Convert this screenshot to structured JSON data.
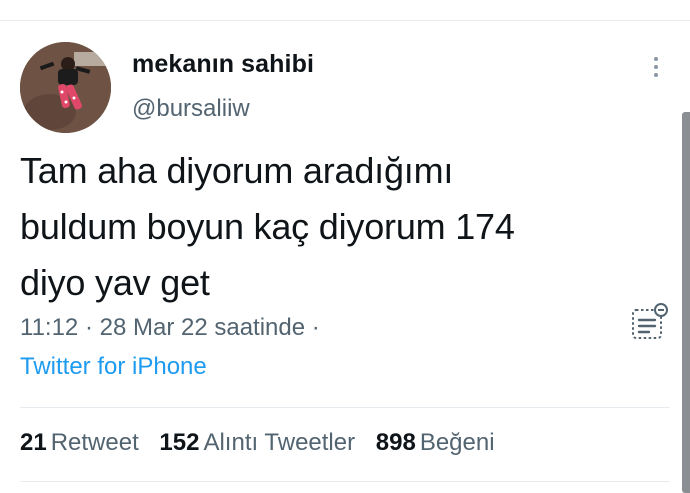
{
  "tweet": {
    "display_name": "mekanın sahibi",
    "handle": "@bursaliiw",
    "text_lines": [
      "Tam aha diyorum aradığımı",
      "buldum boyun kaç diyorum 174",
      "diyo yav get"
    ],
    "time": "11:12",
    "separator": "·",
    "date": "28 Mar 22 saatinde",
    "trailing_separator": "·",
    "source": "Twitter for iPhone"
  },
  "stats": {
    "retweets": {
      "count": "21",
      "label": "Retweet"
    },
    "quotes": {
      "count": "152",
      "label": "Alıntı Tweetler"
    },
    "likes": {
      "count": "898",
      "label": "Beğeni"
    }
  },
  "icons": {
    "more": "more-vertical-icon",
    "analytics": "analytics-icon"
  },
  "colors": {
    "link": "#1d9bf0",
    "secondary_text": "#536471",
    "primary_text": "#0f1419",
    "divider": "#e6ecf0"
  }
}
